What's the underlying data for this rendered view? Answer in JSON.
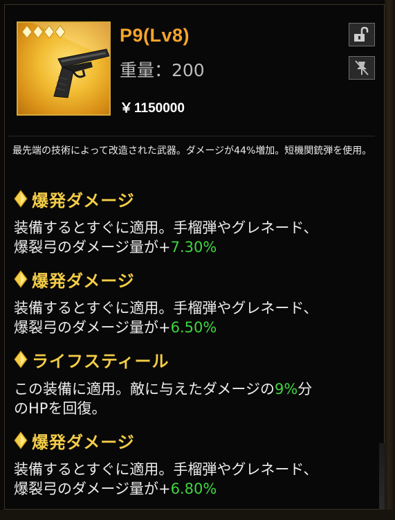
{
  "item": {
    "name": "P9(Lv8)",
    "weight_label": "重量：200",
    "price_symbol": "￥",
    "price_value": "1150000",
    "stars": 4,
    "rarity_color": "#f2bd33"
  },
  "description": "最先端の技術によって改造された武器。ダメージが44%増加。短機関銃弾を使用。",
  "effects": [
    {
      "title": "爆発ダメージ",
      "body_line1": "装備するとすぐに適用。手榴弾やグレネード、",
      "body_line2_prefix": "爆裂弓のダメージ量が",
      "plus": "+",
      "value": "7.30%"
    },
    {
      "title": "爆発ダメージ",
      "body_line1": "装備するとすぐに適用。手榴弾やグレネード、",
      "body_line2_prefix": "爆裂弓のダメージ量が",
      "plus": "+",
      "value": "6.50%"
    },
    {
      "title": "ライフスティール",
      "body_line1_prefix": "この装備に適用。敵に与えたダメージの",
      "value": "9%",
      "body_line1_suffix": "分",
      "body_line2": "のHPを回復。"
    },
    {
      "title": "爆発ダメージ",
      "body_line1": "装備するとすぐに適用。手榴弾やグレネード、",
      "body_line2_prefix": "爆裂弓のダメージ量が",
      "plus": "+",
      "value": "6.80%"
    }
  ],
  "icons": {
    "lock": "lock-icon",
    "unpin": "unpin-icon",
    "diamond": "diamond-bullet-icon",
    "gun": "pistol-icon"
  },
  "colors": {
    "title_orange": "#f6a42b",
    "effect_title_yellow": "#f4cd47",
    "value_green": "#3fd63f"
  }
}
